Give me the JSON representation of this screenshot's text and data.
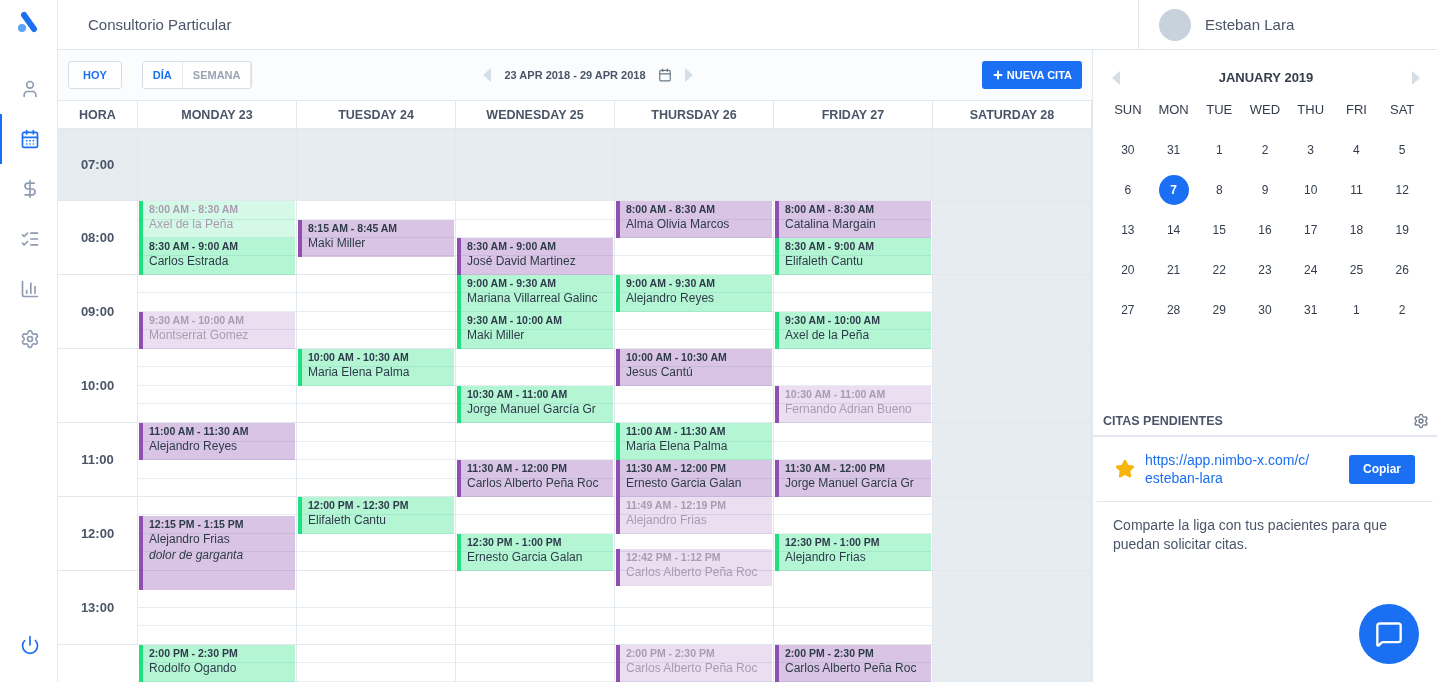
{
  "sidebar": {
    "items": [
      {
        "selected": false
      },
      {
        "selected": true
      },
      {
        "selected": false
      },
      {
        "selected": false
      },
      {
        "selected": false
      },
      {
        "selected": false
      }
    ]
  },
  "topbar": {
    "title": "Consultorio Particular",
    "user": "Esteban Lara"
  },
  "toolbar": {
    "today": "HOY",
    "views": [
      {
        "label": "DÍA",
        "selected": true
      },
      {
        "label": "SEMANA",
        "selected": false
      }
    ],
    "range": "23 APR 2018 - 29 APR 2018",
    "new_button": "NUEVA CITA"
  },
  "calendar": {
    "hour_header": "HORA",
    "hours": [
      {
        "label": "07:00",
        "available": false
      },
      {
        "label": "08:00",
        "available": true
      },
      {
        "label": "09:00",
        "available": true
      },
      {
        "label": "10:00",
        "available": true
      },
      {
        "label": "11:00",
        "available": true
      },
      {
        "label": "12:00",
        "available": true
      },
      {
        "label": "13:00",
        "available": true
      }
    ],
    "days": [
      {
        "label": "MONDAY 23",
        "available": true,
        "events": [
          {
            "time": "8:00 AM - 8:30 AM",
            "name": "Axel de la Peña",
            "color": "#1ee07f",
            "faded": true
          },
          {
            "time": "8:30 AM - 9:00 AM",
            "name": "Carlos Estrada",
            "color": "#1ee07f",
            "faded": false
          },
          {
            "time": "9:30 AM - 10:00 AM",
            "name": "Montserrat Gomez",
            "color": "#8e4fb0",
            "faded": true
          },
          {
            "time": "11:00 AM - 11:30 AM",
            "name": "Alejandro Reyes",
            "color": "#8e4fb0",
            "faded": false
          },
          {
            "time": "12:15 PM - 1:15 PM",
            "name": "Alejandro Frias",
            "note": "dolor de garganta",
            "color": "#8e4fb0",
            "faded": false
          },
          {
            "time": "2:00 PM - 2:30 PM",
            "name": "Rodolfo Ogando",
            "color": "#1ee07f",
            "faded": false
          }
        ]
      },
      {
        "label": "TUESDAY 24",
        "available": true,
        "events": [
          {
            "time": "8:15 AM - 8:45 AM",
            "name": "Maki Miller",
            "color": "#8e4fb0",
            "faded": false
          },
          {
            "time": "10:00 AM - 10:30 AM",
            "name": "Maria Elena Palma",
            "color": "#1ee07f",
            "faded": false
          },
          {
            "time": "12:00 PM - 12:30 PM",
            "name": "Elifaleth Cantu",
            "color": "#1ee07f",
            "faded": false
          }
        ]
      },
      {
        "label": "WEDNESDAY 25",
        "available": true,
        "events": [
          {
            "time": "8:30 AM - 9:00 AM",
            "name": "José David Martinez",
            "color": "#8e4fb0",
            "faded": false
          },
          {
            "time": "9:00 AM - 9:30 AM",
            "name": "Mariana Villarreal Galinc",
            "color": "#1ee07f",
            "faded": false
          },
          {
            "time": "9:30 AM - 10:00 AM",
            "name": "Maki Miller",
            "color": "#1ee07f",
            "faded": false
          },
          {
            "time": "10:30 AM - 11:00 AM",
            "name": "Jorge Manuel García Gr",
            "color": "#1ee07f",
            "faded": false
          },
          {
            "time": "11:30 AM - 12:00 PM",
            "name": "Carlos Alberto Peña Roc",
            "color": "#8e4fb0",
            "faded": false
          },
          {
            "time": "12:30 PM - 1:00 PM",
            "name": "Ernesto Garcia Galan",
            "color": "#1ee07f",
            "faded": false
          }
        ]
      },
      {
        "label": "THURSDAY 26",
        "available": true,
        "events": [
          {
            "time": "8:00 AM - 8:30 AM",
            "name": "Alma Olivia Marcos",
            "color": "#8e4fb0",
            "faded": false
          },
          {
            "time": "9:00 AM - 9:30 AM",
            "name": "Alejandro Reyes",
            "color": "#1ee07f",
            "faded": false
          },
          {
            "time": "10:00 AM - 10:30 AM",
            "name": "Jesus Cantú",
            "color": "#8e4fb0",
            "faded": false
          },
          {
            "time": "11:00 AM - 11:30 AM",
            "name": "Maria Elena Palma",
            "color": "#1ee07f",
            "faded": false
          },
          {
            "time": "11:30 AM - 12:00 PM",
            "name": "Ernesto Garcia Galan",
            "color": "#8e4fb0",
            "faded": false
          },
          {
            "time": "11:49 AM - 12:19 PM",
            "name": "Alejandro Frias",
            "color": "#8e4fb0",
            "faded": true
          },
          {
            "time": "12:42 PM - 1:12 PM",
            "name": "Carlos Alberto Peña Roc",
            "color": "#8e4fb0",
            "faded": true
          },
          {
            "time": "2:00 PM - 2:30 PM",
            "name": "Carlos Alberto Peña Roc",
            "color": "#8e4fb0",
            "faded": true
          }
        ]
      },
      {
        "label": "FRIDAY 27",
        "available": true,
        "events": [
          {
            "time": "8:00 AM - 8:30 AM",
            "name": "Catalina Margain",
            "color": "#8e4fb0",
            "faded": false
          },
          {
            "time": "8:30 AM - 9:00 AM",
            "name": "Elifaleth Cantu",
            "color": "#1ee07f",
            "faded": false
          },
          {
            "time": "9:30 AM - 10:00 AM",
            "name": "Axel de la Peña",
            "color": "#1ee07f",
            "faded": false
          },
          {
            "time": "10:30 AM - 11:00 AM",
            "name": "Fernando Adrian Bueno",
            "color": "#8e4fb0",
            "faded": true
          },
          {
            "time": "11:30 AM - 12:00 PM",
            "name": "Jorge Manuel García Gr",
            "color": "#8e4fb0",
            "faded": false
          },
          {
            "time": "12:30 PM - 1:00 PM",
            "name": "Alejandro Frias",
            "color": "#1ee07f",
            "faded": false
          },
          {
            "time": "2:00 PM - 2:30 PM",
            "name": "Carlos Alberto Peña Roc",
            "color": "#8e4fb0",
            "faded": false
          }
        ]
      },
      {
        "label": "SATURDAY 28",
        "available": false
      }
    ]
  },
  "mini_calendar": {
    "month": "JANUARY 2019",
    "weekdays": [
      "SUN",
      "MON",
      "TUE",
      "WED",
      "THU",
      "FRI",
      "SAT"
    ],
    "weeks": [
      [
        {
          "day": "30",
          "selected": false
        },
        {
          "day": "31",
          "selected": false
        },
        {
          "day": "1",
          "selected": false
        },
        {
          "day": "2",
          "selected": false
        },
        {
          "day": "3",
          "selected": false
        },
        {
          "day": "4",
          "selected": false
        },
        {
          "day": "5",
          "selected": false
        }
      ],
      [
        {
          "day": "6",
          "selected": false
        },
        {
          "day": "7",
          "selected": true
        },
        {
          "day": "8",
          "selected": false
        },
        {
          "day": "9",
          "selected": false
        },
        {
          "day": "10",
          "selected": false
        },
        {
          "day": "11",
          "selected": false
        },
        {
          "day": "12",
          "selected": false
        }
      ],
      [
        {
          "day": "13",
          "selected": false
        },
        {
          "day": "14",
          "selected": false
        },
        {
          "day": "15",
          "selected": false
        },
        {
          "day": "16",
          "selected": false
        },
        {
          "day": "17",
          "selected": false
        },
        {
          "day": "18",
          "selected": false
        },
        {
          "day": "19",
          "selected": false
        }
      ],
      [
        {
          "day": "20",
          "selected": false
        },
        {
          "day": "21",
          "selected": false
        },
        {
          "day": "22",
          "selected": false
        },
        {
          "day": "23",
          "selected": false
        },
        {
          "day": "24",
          "selected": false
        },
        {
          "day": "25",
          "selected": false
        },
        {
          "day": "26",
          "selected": false
        }
      ],
      [
        {
          "day": "27",
          "selected": false
        },
        {
          "day": "28",
          "selected": false
        },
        {
          "day": "29",
          "selected": false
        },
        {
          "day": "30",
          "selected": false
        },
        {
          "day": "31",
          "selected": false
        },
        {
          "day": "1",
          "selected": false
        },
        {
          "day": "2",
          "selected": false
        }
      ]
    ]
  },
  "pending": {
    "title": "CITAS PENDIENTES",
    "link": "https://app.nimbo-x.com/c/esteban-lara",
    "copy_button": "Copiar",
    "hint": "Comparte la liga con tus pacientes para que puedan solicitar citas."
  }
}
